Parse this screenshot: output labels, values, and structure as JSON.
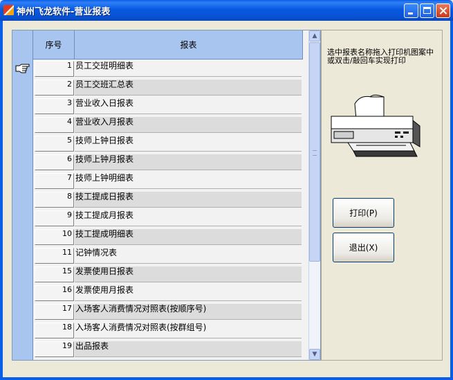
{
  "window": {
    "title": "神州飞龙软件-营业报表"
  },
  "table": {
    "headers": {
      "num": "序号",
      "name": "报表"
    },
    "rows": [
      {
        "num": "1",
        "name": "员工交班明细表"
      },
      {
        "num": "2",
        "name": "员工交班汇总表"
      },
      {
        "num": "3",
        "name": "营业收入日报表"
      },
      {
        "num": "4",
        "name": "营业收入月报表"
      },
      {
        "num": "5",
        "name": "技师上钟日报表"
      },
      {
        "num": "6",
        "name": "技师上钟月报表"
      },
      {
        "num": "7",
        "name": "技师上钟明细表"
      },
      {
        "num": "8",
        "name": "技工提成日报表"
      },
      {
        "num": "9",
        "name": "技工提成月报表"
      },
      {
        "num": "10",
        "name": "技工提成明细表"
      },
      {
        "num": "11",
        "name": "记钟情况表"
      },
      {
        "num": "15",
        "name": "发票使用日报表"
      },
      {
        "num": "16",
        "name": "发票使用月报表"
      },
      {
        "num": "17",
        "name": "入场客人消费情况对照表(按顺序号)"
      },
      {
        "num": "18",
        "name": "入场客人消费情况对照表(按群组号)"
      },
      {
        "num": "19",
        "name": "出品报表"
      }
    ]
  },
  "panel": {
    "hint": "选中报表名称拖入打印机图案中或双击/敲回车实现打印",
    "print_label": "打印(P)",
    "exit_label": "退出(X)"
  },
  "colors": {
    "titlebar": "#0a5de6",
    "header": "#a8c5ef"
  }
}
